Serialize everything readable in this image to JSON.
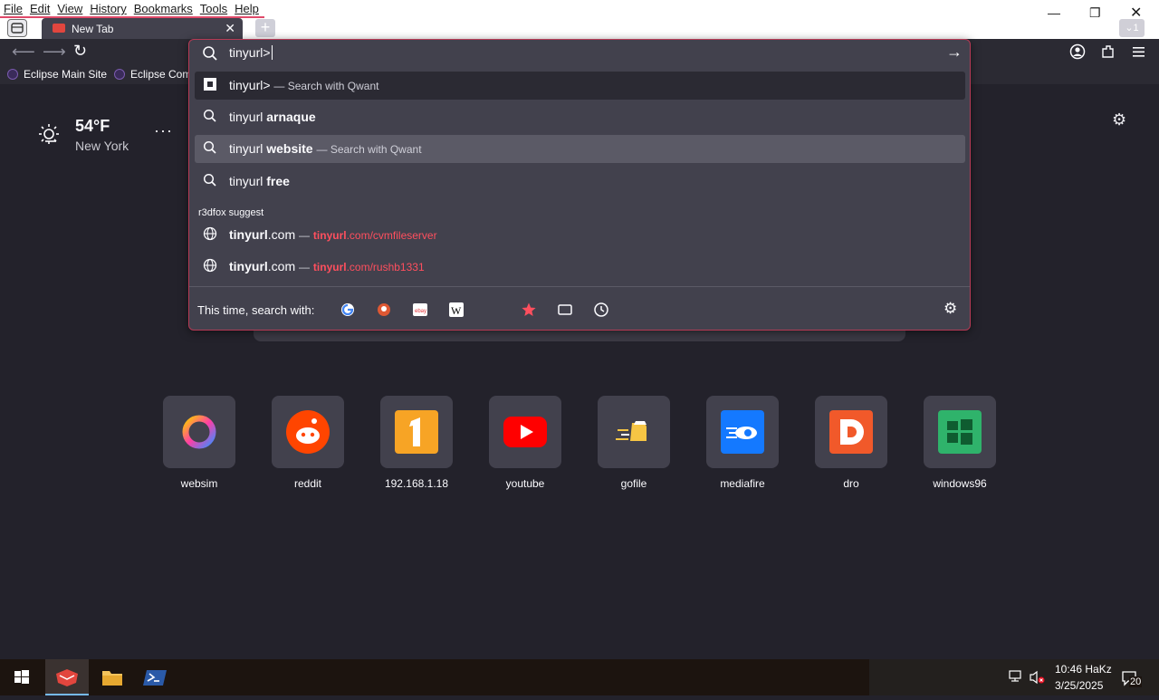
{
  "menu": [
    "File",
    "Edit",
    "View",
    "History",
    "Bookmarks",
    "Tools",
    "Help"
  ],
  "tab": {
    "title": "New Tab"
  },
  "new_tab_symbol": "+",
  "list_all_tabs": "1",
  "bookmarks": [
    {
      "label": "Eclipse Main Site"
    },
    {
      "label": "Eclipse Com"
    }
  ],
  "weather": {
    "temp": "54°F",
    "city": "New York",
    "more": "···"
  },
  "urlbar": {
    "input_value": "tinyurl>",
    "suggestions": [
      {
        "query": "tinyurl>",
        "bold": "",
        "suffix": "— Search with Qwant",
        "icon": "qwant-icon"
      },
      {
        "query": "tinyurl ",
        "bold": "arnaque",
        "suffix": "",
        "icon": "search-icon"
      },
      {
        "query": "tinyurl ",
        "bold": "website",
        "suffix": "— Search with Qwant",
        "icon": "search-icon"
      },
      {
        "query": "tinyurl ",
        "bold": "free",
        "suffix": "",
        "icon": "search-icon"
      }
    ],
    "group_label": "r3dfox suggest",
    "urls": [
      {
        "bold": "tinyurl",
        "rest": ".com",
        "dash": "—",
        "url_bold": "tinyurl",
        "url_rest": ".com/cvmfileserver"
      },
      {
        "bold": "tinyurl",
        "rest": ".com",
        "dash": "—",
        "url_bold": "tinyurl",
        "url_rest": ".com/rushb1331"
      }
    ],
    "oneoff_label": "This time, search with:"
  },
  "top_sites": [
    {
      "label": "websim"
    },
    {
      "label": "reddit"
    },
    {
      "label": "192.168.1.18"
    },
    {
      "label": "youtube"
    },
    {
      "label": "gofile"
    },
    {
      "label": "mediafire"
    },
    {
      "label": "dro"
    },
    {
      "label": "windows96"
    }
  ],
  "taskbar": {
    "time": "10:46 HaKz",
    "date": "3/25/2025",
    "notifications": "20"
  },
  "colors": {
    "accent": "#ff4f5e",
    "border": "#b63a55",
    "bg": "#23222b",
    "panel": "#42414d"
  }
}
